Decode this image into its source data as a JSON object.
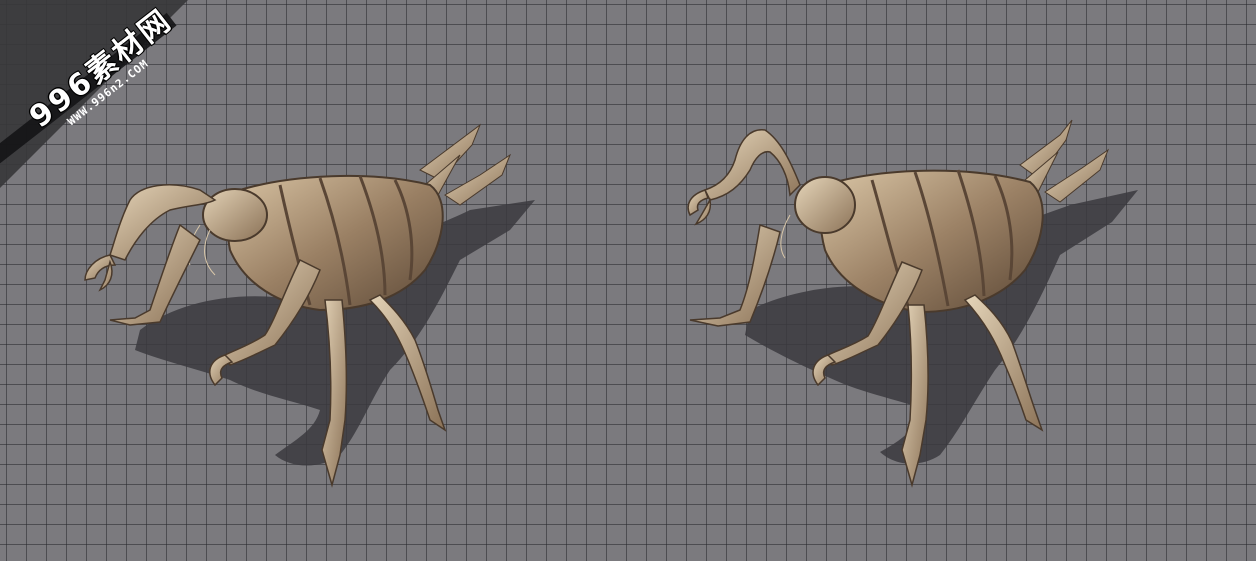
{
  "watermark": {
    "main_text": "996素材网",
    "url_text": "WWW.996n2.COM"
  },
  "scene": {
    "background_color": "#7b7a7e",
    "grid_line_color": "#3a3a3e",
    "creature_color": "#b39a7c",
    "shadow_color": "#3b3a3e",
    "creatures": [
      {
        "name": "scorpion-creature-left-view"
      },
      {
        "name": "scorpion-creature-right-view"
      }
    ]
  }
}
